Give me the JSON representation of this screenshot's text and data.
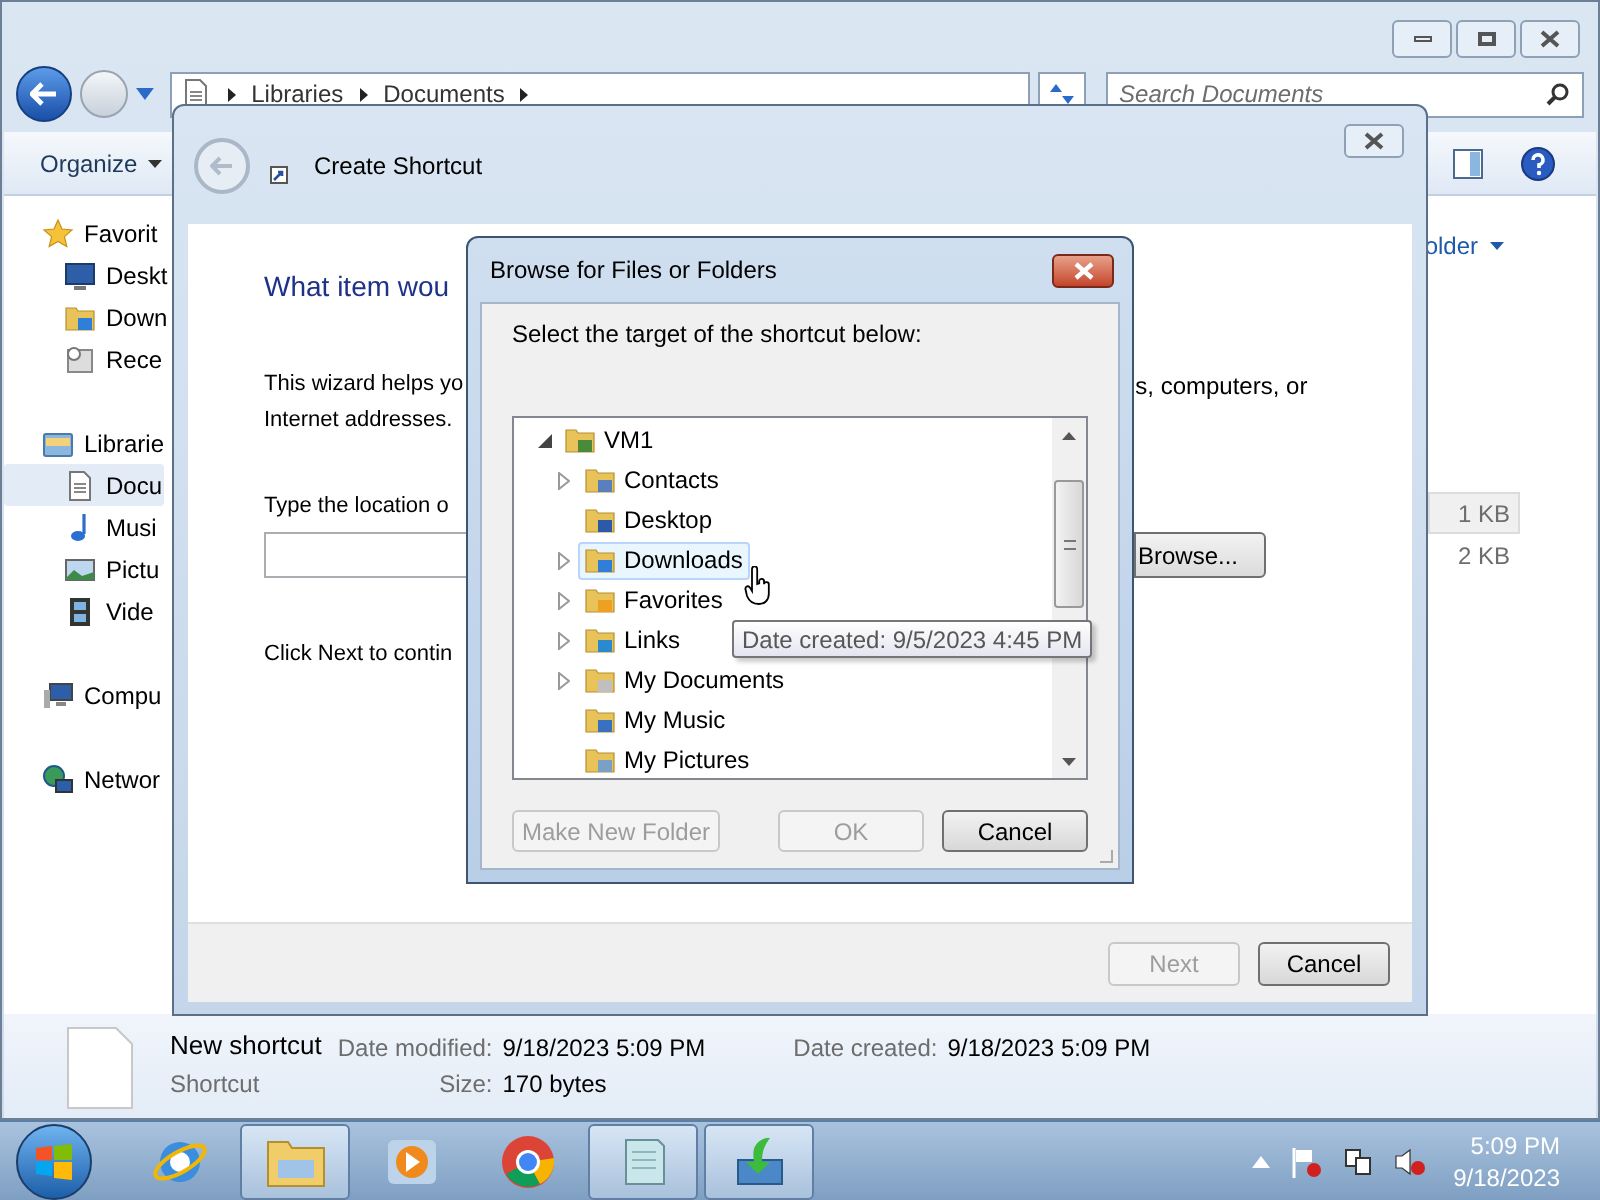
{
  "explorer": {
    "breadcrumb": [
      "Libraries",
      "Documents"
    ],
    "search": {
      "placeholder": "Search Documents"
    },
    "toolbar": {
      "organize": "Organize"
    },
    "sidebar": [
      {
        "label": "Favorit",
        "kind": "star",
        "selected": false,
        "children": [
          {
            "label": "Deskt",
            "kind": "desktop",
            "selected": false
          },
          {
            "label": "Down",
            "kind": "downloads",
            "selected": false
          },
          {
            "label": "Rece",
            "kind": "recent",
            "selected": false
          }
        ]
      },
      {
        "label": "Librarie",
        "kind": "libraries",
        "selected": false,
        "children": [
          {
            "label": "Docu",
            "kind": "documents",
            "selected": true
          },
          {
            "label": "Musi",
            "kind": "music",
            "selected": false
          },
          {
            "label": "Pictu",
            "kind": "pictures",
            "selected": false
          },
          {
            "label": "Vide",
            "kind": "videos",
            "selected": false
          }
        ]
      },
      {
        "label": "Compu",
        "kind": "computer",
        "selected": false
      },
      {
        "label": "Networ",
        "kind": "network",
        "selected": false
      }
    ],
    "arrange": "older",
    "files": [
      {
        "size": "1 KB",
        "selected": true
      },
      {
        "size": "2 KB",
        "selected": false
      }
    ],
    "details": {
      "name": "New shortcut",
      "type": "Shortcut",
      "fields": [
        {
          "label": "Date modified:",
          "value": "9/18/2023 5:09 PM"
        },
        {
          "label": "Size:",
          "value": "170 bytes"
        }
      ],
      "created": {
        "label": "Date created:",
        "value": "9/18/2023 5:09 PM"
      }
    }
  },
  "wizard": {
    "title": "Create Shortcut",
    "heading": "What item wou",
    "intro": [
      "This wizard helps yo",
      "s, computers, or"
    ],
    "intro_line2": "Internet addresses.",
    "location_label": "Type the location o",
    "browse": "Browse...",
    "next_hint": "Click Next to contin",
    "buttons": [
      {
        "label": "Next",
        "disabled": true
      },
      {
        "label": "Cancel",
        "disabled": false
      }
    ]
  },
  "browse": {
    "title": "Browse for Files or Folders",
    "prompt": "Select the target of the shortcut below:",
    "tree": [
      {
        "label": "VM1",
        "kind": "user",
        "has_children": true,
        "expanded": true,
        "hovered": false,
        "children": [
          {
            "label": "Contacts",
            "kind": "contacts",
            "has_children": true,
            "expanded": false,
            "hovered": false
          },
          {
            "label": "Desktop",
            "kind": "desktop",
            "has_children": false,
            "expanded": false,
            "hovered": false
          },
          {
            "label": "Downloads",
            "kind": "downloads",
            "has_children": true,
            "expanded": false,
            "hovered": true
          },
          {
            "label": "Favorites",
            "kind": "favorites",
            "has_children": true,
            "expanded": false,
            "hovered": false
          },
          {
            "label": "Links",
            "kind": "links",
            "has_children": true,
            "expanded": false,
            "hovered": false
          },
          {
            "label": "My Documents",
            "kind": "documents",
            "has_children": true,
            "expanded": false,
            "hovered": false
          },
          {
            "label": "My Music",
            "kind": "music",
            "has_children": false,
            "expanded": false,
            "hovered": false
          },
          {
            "label": "My Pictures",
            "kind": "pictures",
            "has_children": false,
            "expanded": false,
            "hovered": false
          }
        ]
      }
    ],
    "tooltip": "Date created: 9/5/2023 4:45 PM",
    "buttons": [
      {
        "label": "Make New Folder",
        "disabled": true
      },
      {
        "label": "OK",
        "disabled": true
      },
      {
        "label": "Cancel",
        "disabled": false
      }
    ]
  },
  "taskbar": {
    "apps": [
      {
        "kind": "ie",
        "open": false
      },
      {
        "kind": "explorer",
        "open": true
      },
      {
        "kind": "media",
        "open": false
      },
      {
        "kind": "chrome",
        "open": false
      },
      {
        "kind": "notepad",
        "open": true
      },
      {
        "kind": "install",
        "open": true
      }
    ],
    "clock": {
      "time": "5:09 PM",
      "date": "9/18/2023"
    }
  }
}
